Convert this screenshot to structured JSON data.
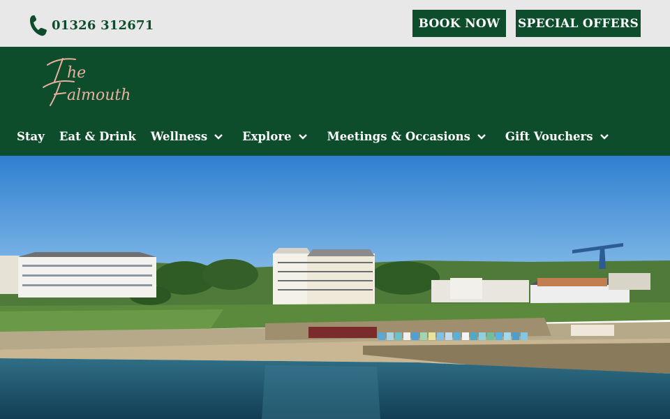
{
  "topbar": {
    "phone_icon": "phone-icon",
    "phone_number": "01326 312671",
    "book_label": "BOOK NOW",
    "offers_label": "SPECIAL OFFERS"
  },
  "brand": {
    "logo_line1": "The",
    "logo_line2": "Falmouth"
  },
  "nav": {
    "items": [
      {
        "label": "Stay",
        "has_dropdown": false
      },
      {
        "label": "Eat & Drink",
        "has_dropdown": false
      },
      {
        "label": "Wellness",
        "has_dropdown": true
      },
      {
        "label": "Explore",
        "has_dropdown": true
      },
      {
        "label": "Meetings & Occasions",
        "has_dropdown": true
      },
      {
        "label": "Gift Vouchers",
        "has_dropdown": true
      }
    ]
  },
  "colors": {
    "brand_green": "#0e4d2c",
    "topbar_bg": "#e8e8e8",
    "logo_pink": "#e8b0a0"
  }
}
